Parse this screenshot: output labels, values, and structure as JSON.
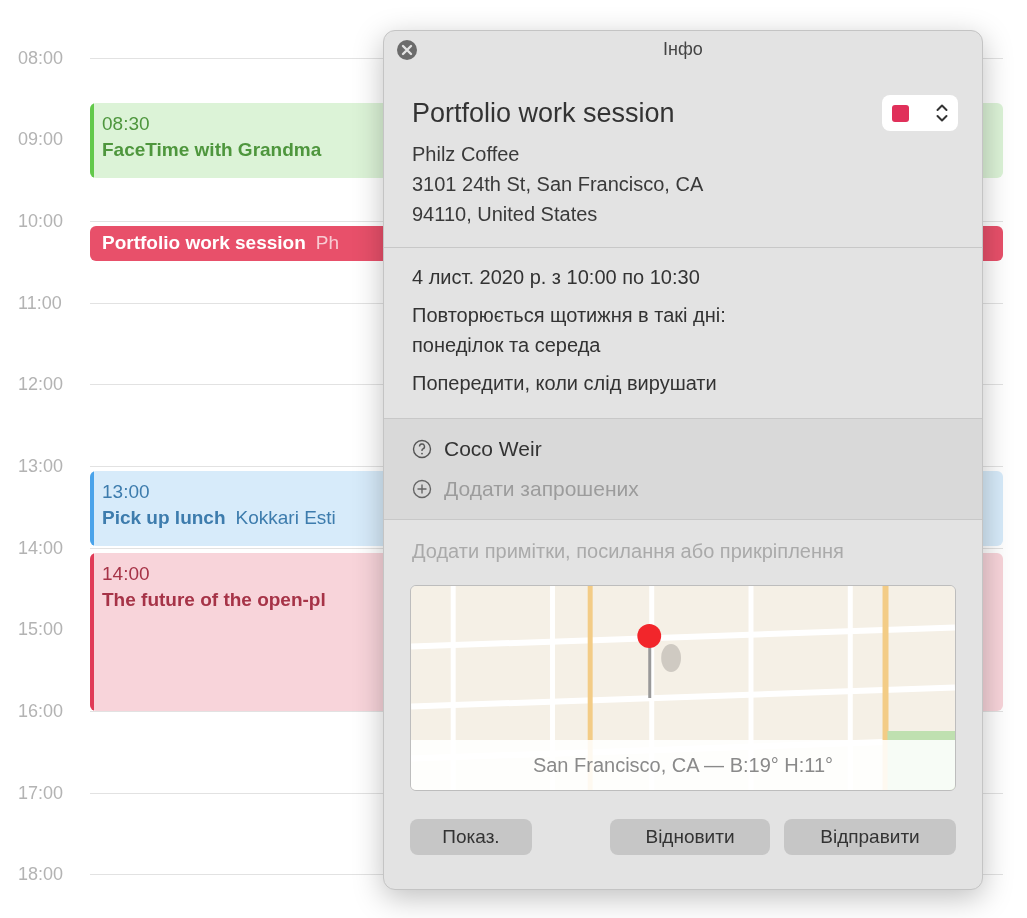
{
  "calendar": {
    "hours": [
      "08:00",
      "09:00",
      "10:00",
      "11:00",
      "12:00",
      "13:00",
      "14:00",
      "15:00",
      "16:00",
      "17:00",
      "18:00"
    ],
    "events": [
      {
        "kind": "block",
        "time": "08:30",
        "title": "FaceTime with Grandma",
        "color": "#62c94a"
      },
      {
        "kind": "bar",
        "title": "Portfolio work session",
        "location": "Ph",
        "color": "#e8506a"
      },
      {
        "kind": "block",
        "time": "13:00",
        "title": "Pick up lunch",
        "location": "Kokkari Esti",
        "color": "#4aa3ea"
      },
      {
        "kind": "block",
        "time": "14:00",
        "title": "The future of the open-pl",
        "color": "#e03b57"
      }
    ]
  },
  "popover": {
    "title": "Інфо",
    "event_title": "Portfolio work session",
    "calendar": {
      "color": "#e0305a"
    },
    "location": [
      "Philz Coffee",
      "3101 24th St, San Francisco, CA",
      "94110, United States"
    ],
    "date": "4 лист. 2020 р. з 10:00 по 10:30",
    "repeat": "Повторюється щотижня в такі дні:\nпонеділок та середа",
    "alert": "Попередити, коли слід вирушати",
    "invitees": [
      {
        "kind": "person",
        "name": "Coco Weir"
      },
      {
        "kind": "add",
        "name": "Додати запрошених"
      }
    ],
    "notes": {
      "placeholder": "Додати примітки, посилання або прикріплення"
    },
    "map": {
      "kind": "picture",
      "caption": "San Francisco, CA — В:19° Н:11°"
    },
    "buttons": [
      "Показ.",
      "Відновити",
      "Відправити"
    ]
  }
}
